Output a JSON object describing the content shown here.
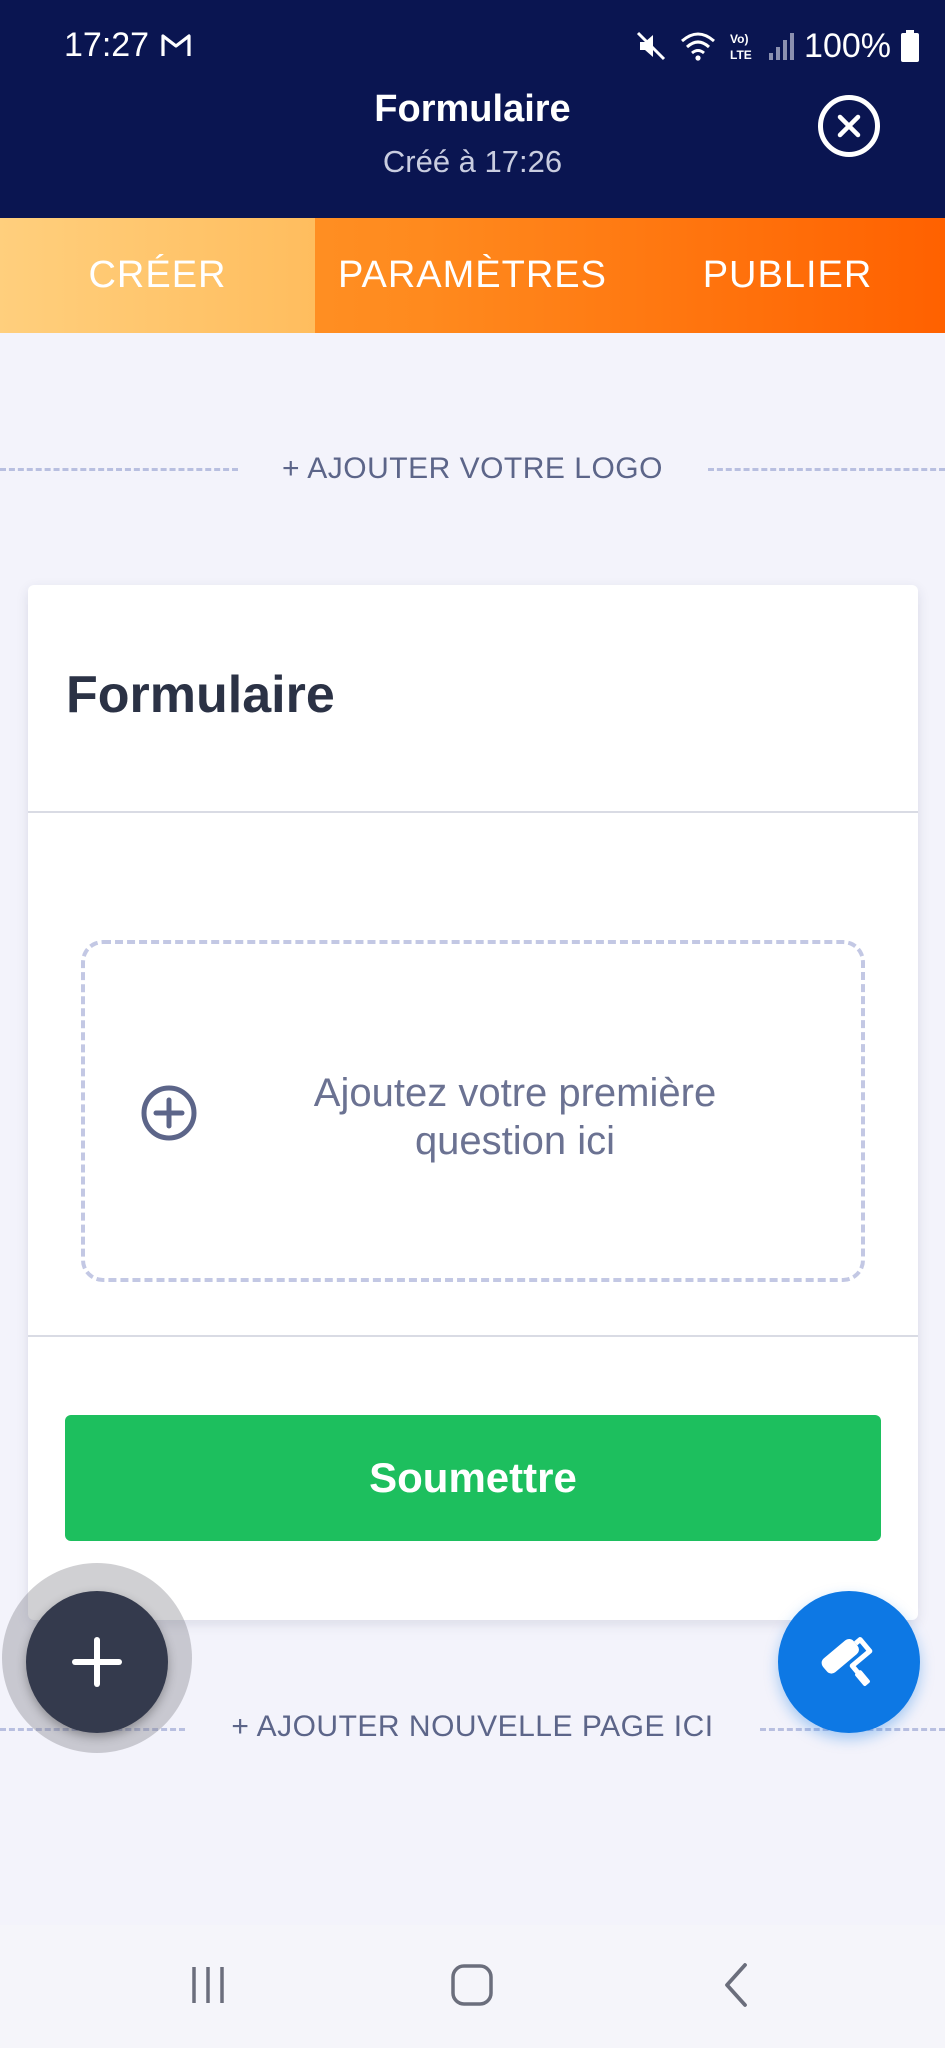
{
  "status_bar": {
    "time": "17:27",
    "battery": "100%",
    "icons": [
      "gmail-icon",
      "mute-icon",
      "wifi-icon",
      "volte-icon",
      "signal-icon",
      "battery-icon"
    ]
  },
  "header": {
    "title": "Formulaire",
    "subtitle": "Créé à 17:26",
    "close_icon": "close-circle-icon"
  },
  "tabs": [
    {
      "label": "CRÉER",
      "active": true
    },
    {
      "label": "PARAMÈTRES",
      "active": false
    },
    {
      "label": "PUBLIER",
      "active": false
    }
  ],
  "logo_row": {
    "label": "+ AJOUTER VOTRE LOGO"
  },
  "form": {
    "title": "Formulaire",
    "add_question": {
      "text": "Ajoutez votre première question ici",
      "icon": "plus-circle-icon"
    },
    "submit_label": "Soumettre"
  },
  "new_page_row": {
    "label": "+ AJOUTER NOUVELLE PAGE ICI"
  },
  "fabs": {
    "add_icon": "plus-icon",
    "paint_icon": "paint-roller-icon"
  },
  "colors": {
    "header_bg": "#0a1551",
    "tab_gradient_start": "#ff9a2e",
    "tab_gradient_end": "#ff6100",
    "tab_active": "#ffc46a",
    "submit": "#1dbf5e",
    "paint_fab": "#0d78e4",
    "add_fab": "#343a4d"
  }
}
